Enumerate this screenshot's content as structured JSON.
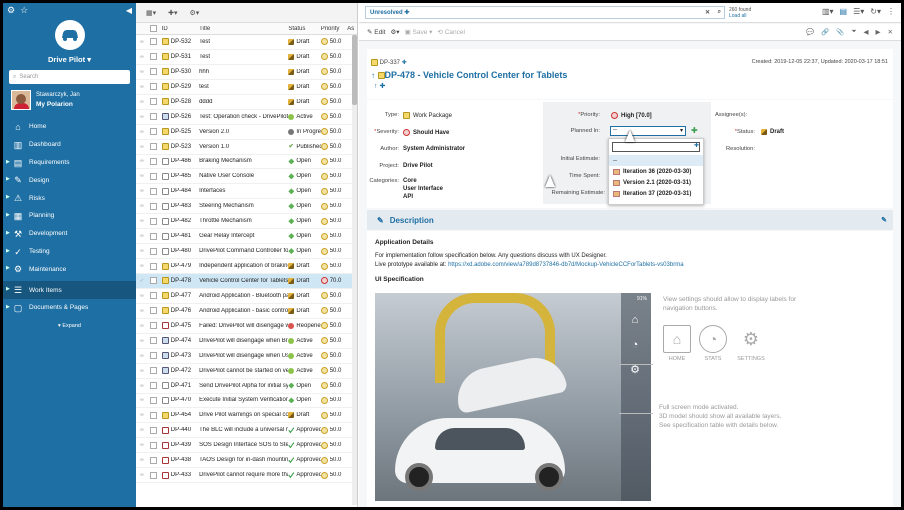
{
  "sidebar": {
    "project": "Drive Pilot",
    "search_placeholder": "Search",
    "user_name": "Stawarczyk, Jan",
    "user_link": "My Polarion",
    "items": [
      {
        "label": "Home",
        "icon": "home-icon"
      },
      {
        "label": "Dashboard",
        "icon": "dashboard-icon"
      },
      {
        "label": "Requirements",
        "icon": "requirements-icon"
      },
      {
        "label": "Design",
        "icon": "design-icon"
      },
      {
        "label": "Risks",
        "icon": "risks-icon"
      },
      {
        "label": "Planning",
        "icon": "planning-icon"
      },
      {
        "label": "Development",
        "icon": "development-icon"
      },
      {
        "label": "Testing",
        "icon": "testing-icon"
      },
      {
        "label": "Maintenance",
        "icon": "maintenance-icon"
      },
      {
        "label": "Work Items",
        "icon": "work-items-icon"
      },
      {
        "label": "Documents & Pages",
        "icon": "documents-icon"
      }
    ],
    "expand": "Expand"
  },
  "list": {
    "headers": [
      "ID",
      "Title",
      "Status",
      "Priority",
      "As"
    ],
    "rows": [
      {
        "id": "DP-532",
        "title": "Test",
        "status": "Draft",
        "st": "draft",
        "priority": "50.0",
        "type": "wp"
      },
      {
        "id": "DP-531",
        "title": "Test",
        "status": "Draft",
        "st": "draft",
        "priority": "50.0",
        "type": "wp"
      },
      {
        "id": "DP-530",
        "title": "hhh",
        "status": "Draft",
        "st": "draft",
        "priority": "50.0",
        "type": "wp"
      },
      {
        "id": "DP-529",
        "title": "test",
        "status": "Draft",
        "st": "draft",
        "priority": "50.0",
        "type": "wp"
      },
      {
        "id": "DP-528",
        "title": "dddd",
        "status": "Draft",
        "st": "draft",
        "priority": "50.0",
        "type": "wp"
      },
      {
        "id": "DP-526",
        "title": "Test: Operation check - DrivePilot switch",
        "status": "Active",
        "st": "active",
        "priority": "50.0",
        "type": "tc"
      },
      {
        "id": "DP-525",
        "title": "Version 2.0",
        "status": "In Progress",
        "st": "prog",
        "priority": "50.0",
        "type": "wp"
      },
      {
        "id": "DP-523",
        "title": "Version 1.0",
        "status": "Published",
        "st": "pub",
        "priority": "50.0",
        "type": "wp"
      },
      {
        "id": "DP-486",
        "title": "Braking Mechanism",
        "status": "Open",
        "st": "open",
        "priority": "50.0",
        "type": "n"
      },
      {
        "id": "DP-485",
        "title": "Native User Console",
        "status": "Open",
        "st": "open",
        "priority": "50.0",
        "type": "n"
      },
      {
        "id": "DP-484",
        "title": "Interfaces",
        "status": "Open",
        "st": "open",
        "priority": "50.0",
        "type": "n"
      },
      {
        "id": "DP-483",
        "title": "Steering Mechanism",
        "status": "Open",
        "st": "open",
        "priority": "50.0",
        "type": "n"
      },
      {
        "id": "DP-482",
        "title": "Throttle Mechanism",
        "status": "Open",
        "st": "open",
        "priority": "50.0",
        "type": "n"
      },
      {
        "id": "DP-481",
        "title": "Gear Relay Intercept",
        "status": "Open",
        "st": "open",
        "priority": "50.0",
        "type": "n"
      },
      {
        "id": "DP-480",
        "title": "DrivePilot Command Controller for cars",
        "status": "Open",
        "st": "open",
        "priority": "50.0",
        "type": "n"
      },
      {
        "id": "DP-479",
        "title": "Independent application of braking",
        "status": "Draft",
        "st": "draft",
        "priority": "50.0",
        "type": "wp"
      },
      {
        "id": "DP-478",
        "title": "Vehicle Control Center for Tablets",
        "status": "Draft",
        "st": "draft",
        "priority": "70.0",
        "type": "wp",
        "sel": true
      },
      {
        "id": "DP-477",
        "title": "Android Application - Bluetooth pairing",
        "status": "Draft",
        "st": "draft",
        "priority": "50.0",
        "type": "wp"
      },
      {
        "id": "DP-476",
        "title": "Android Application - basic controls",
        "status": "Draft",
        "st": "draft",
        "priority": "50.0",
        "type": "wp"
      },
      {
        "id": "DP-475",
        "title": "Failed: DrivePilot will disengage when",
        "status": "Reopened",
        "st": "reo",
        "priority": "50.0",
        "type": "req"
      },
      {
        "id": "DP-474",
        "title": "DrivePilot will disengage when Brake",
        "status": "Active",
        "st": "active",
        "priority": "50.0",
        "type": "tc"
      },
      {
        "id": "DP-473",
        "title": "DrivePilot will disengage when User",
        "status": "Active",
        "st": "active",
        "priority": "50.0",
        "type": "tc"
      },
      {
        "id": "DP-472",
        "title": "DrivePilot cannot be started on vehicle",
        "status": "Active",
        "st": "active",
        "priority": "50.0",
        "type": "tc"
      },
      {
        "id": "DP-471",
        "title": "Send DrivePilot Alpha for initial system",
        "status": "Open",
        "st": "open",
        "priority": "50.0",
        "type": "n"
      },
      {
        "id": "DP-470",
        "title": "Execute Initial System Verification",
        "status": "Open",
        "st": "open",
        "priority": "50.0",
        "type": "n"
      },
      {
        "id": "DP-454",
        "title": "Drive Pilot warnings on special conditions",
        "status": "Draft",
        "st": "draft",
        "priority": "50.0",
        "type": "wp"
      },
      {
        "id": "DP-440",
        "title": "The BLC will include a universal mode",
        "status": "Approved",
        "st": "app",
        "priority": "50.0",
        "type": "req"
      },
      {
        "id": "DP-439",
        "title": "SOS Design Interface SOS to Steering",
        "status": "Approved",
        "st": "app",
        "priority": "50.0",
        "type": "req"
      },
      {
        "id": "DP-438",
        "title": "TAOS Design for in-dash mounting",
        "status": "Approved",
        "st": "app",
        "priority": "50.0",
        "type": "req"
      },
      {
        "id": "DP-433",
        "title": "DrivePilot cannot require more than",
        "status": "Approved",
        "st": "app",
        "priority": "50.0",
        "type": "req"
      }
    ]
  },
  "topbar": {
    "filter": "Unresolved",
    "found": "260 found",
    "load_all": "Load all"
  },
  "edit_tb": {
    "edit": "Edit",
    "save": "Save",
    "cancel": "Cancel"
  },
  "item": {
    "parent_id": "DP-337",
    "id": "DP-478",
    "title": "Vehicle Control Center for Tablets",
    "dates": "Created: 2019-12-05 22:37, Updated: 2020-03-17 18:51",
    "type_label": "Type:",
    "type": "Work Package",
    "severity_label": "Severity:",
    "severity": "Should Have",
    "author_label": "Author:",
    "author": "System Administrator",
    "project_label": "Project:",
    "project": "Drive Pilot",
    "categories_label": "Categories:",
    "categories": [
      "Core",
      "User Interface",
      "API"
    ],
    "priority_label": "Priority:",
    "priority": "High [70.0]",
    "planned_label": "Planned In:",
    "planned": "--",
    "initial_label": "Initial Estimate:",
    "time_label": "Time Spent:",
    "remaining_label": "Remaining Estimate:",
    "assignee_label": "Assignee(s):",
    "status_label": "Status:",
    "status": "Draft",
    "resolution_label": "Resolution:",
    "options": [
      "--",
      "Iteration 36 (2020-03-30)",
      "Version 2.1 (2020-03-31)",
      "Iteration 37 (2020-03-31)"
    ]
  },
  "description": {
    "heading": "Description",
    "app_details": "Application Details",
    "line1": "For implementation follow specification below. Any questions discuss with UX Designer.",
    "line2": "Live prototype available at:",
    "link": "https://xd.adobe.com/view/a789d8737846-db7d/Mockup-VehicleCCForTablets-vs03brma",
    "ui_spec": "UI Specification",
    "battery": "91%",
    "callout1": "View settings should allow to display labels for navigation buttons.",
    "home": "HOME",
    "stats": "STATS",
    "settings": "SETTINGS",
    "callout2a": "Full screen mode activated.",
    "callout2b": "3D model should show all available layers.",
    "callout2c": "See specification table with details below."
  }
}
